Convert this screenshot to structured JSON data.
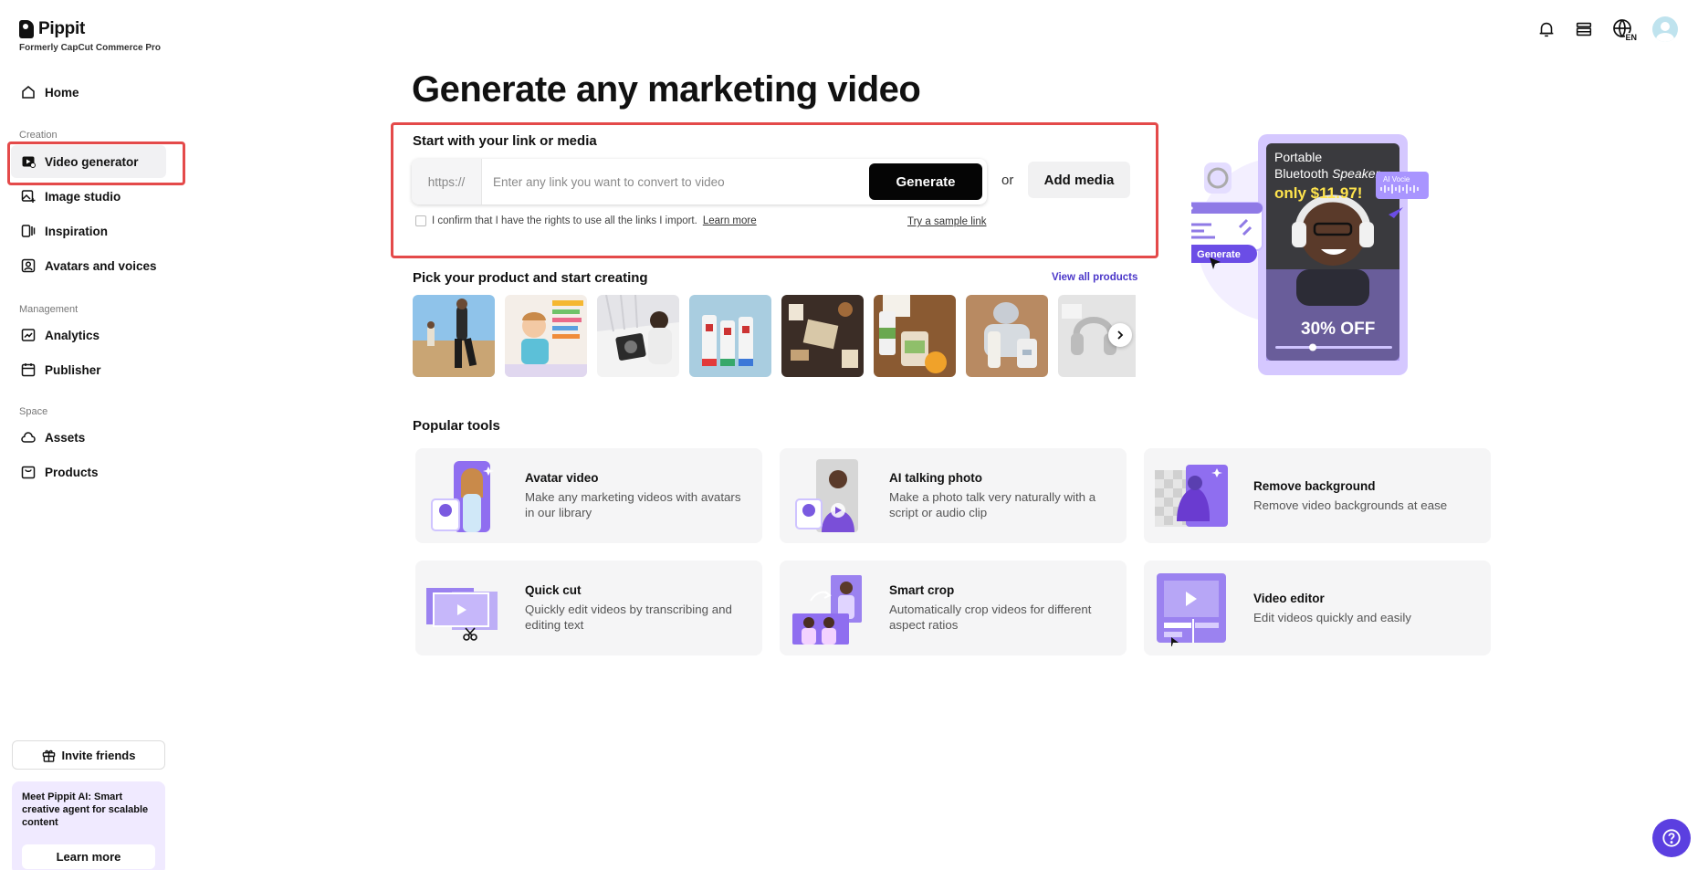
{
  "brand": {
    "name": "Pippit",
    "subtitle": "Formerly CapCut Commerce Pro"
  },
  "sidebar": {
    "home": "Home",
    "sections": {
      "creation": "Creation",
      "management": "Management",
      "space": "Space"
    },
    "items": [
      {
        "label": "Video generator",
        "icon": "video-generator-icon",
        "active": true
      },
      {
        "label": "Image studio",
        "icon": "image-studio-icon"
      },
      {
        "label": "Inspiration",
        "icon": "inspiration-icon"
      },
      {
        "label": "Avatars and voices",
        "icon": "avatar-icon"
      },
      {
        "label": "Analytics",
        "icon": "analytics-icon"
      },
      {
        "label": "Publisher",
        "icon": "calendar-icon"
      },
      {
        "label": "Assets",
        "icon": "cloud-icon"
      },
      {
        "label": "Products",
        "icon": "bag-icon"
      }
    ],
    "invite": "Invite friends",
    "promo": {
      "text": "Meet Pippit AI: Smart creative agent for scalable content",
      "button": "Learn more"
    }
  },
  "header": {
    "lang": "EN",
    "icons": [
      "bell-icon",
      "credits-icon",
      "globe-icon",
      "avatar"
    ]
  },
  "main": {
    "title": "Generate any marketing video",
    "link_section": {
      "title": "Start with your link or media",
      "prefix": "https://",
      "placeholder": "Enter any link you want to convert to video",
      "generate": "Generate",
      "or": "or",
      "add_media": "Add media",
      "confirm": "I confirm that I have the rights to use all the links I import.",
      "learn_more": "Learn more",
      "sample": "Try a sample link"
    },
    "products": {
      "title": "Pick your product and start creating",
      "view_all": "View all products",
      "count_visible": 8
    },
    "hero": {
      "line1": "Portable",
      "line2a": "Bluetooth",
      "line2b": "Speaker",
      "price": "only $11.97!",
      "discount": "30% OFF",
      "voice_badge": "AI Vocie",
      "generate": "Generate"
    },
    "tools": {
      "title": "Popular tools",
      "items": [
        {
          "name": "Avatar video",
          "desc": "Make any marketing videos with avatars in our library"
        },
        {
          "name": "AI talking photo",
          "desc": "Make a photo talk very naturally with a script or audio clip"
        },
        {
          "name": "Remove background",
          "desc": "Remove video backgrounds at ease"
        },
        {
          "name": "Quick cut",
          "desc": "Quickly edit videos by transcribing and editing text"
        },
        {
          "name": "Smart crop",
          "desc": "Automatically crop videos for different aspect ratios"
        },
        {
          "name": "Video editor",
          "desc": "Edit videos quickly and easily"
        }
      ]
    }
  },
  "colors": {
    "accent": "#5b3fe0",
    "highlight": "#e44a4a",
    "primary_button": "#050505"
  }
}
